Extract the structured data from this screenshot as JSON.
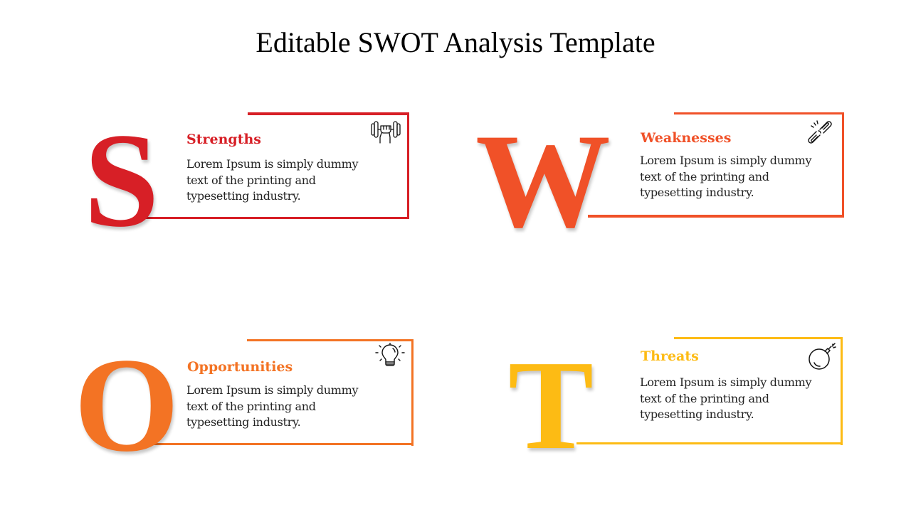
{
  "title": "Editable SWOT Analysis Template",
  "colors": {
    "strengths": "#D71F26",
    "weaknesses": "#F05128",
    "opportunities": "#F37324",
    "threats": "#FDBB14",
    "text": "#222222"
  },
  "quadrants": [
    {
      "letter": "S",
      "heading": "Strengths",
      "body": "Lorem Ipsum is simply dummy text of the printing and typesetting industry.",
      "icon": "dumbbell-fist-icon"
    },
    {
      "letter": "W",
      "heading": "Weaknesses",
      "body": "Lorem Ipsum is simply dummy text of the printing and typesetting industry.",
      "icon": "broken-chain-icon"
    },
    {
      "letter": "O",
      "heading": "Opportunities",
      "body": "Lorem Ipsum is simply dummy text of the printing and typesetting industry.",
      "icon": "lightbulb-icon"
    },
    {
      "letter": "T",
      "heading": "Threats",
      "body": "Lorem Ipsum is simply dummy text of the printing and typesetting industry.",
      "icon": "bomb-icon"
    }
  ]
}
